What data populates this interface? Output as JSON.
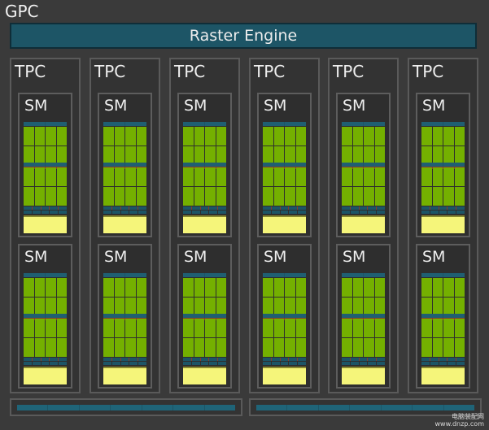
{
  "gpc": {
    "title": "GPC",
    "raster_engine_label": "Raster Engine",
    "tpcs": [
      {
        "label": "TPC",
        "sms": [
          {
            "label": "SM"
          },
          {
            "label": "SM"
          }
        ]
      },
      {
        "label": "TPC",
        "sms": [
          {
            "label": "SM"
          },
          {
            "label": "SM"
          }
        ]
      },
      {
        "label": "TPC",
        "sms": [
          {
            "label": "SM"
          },
          {
            "label": "SM"
          }
        ]
      },
      {
        "label": "TPC",
        "sms": [
          {
            "label": "SM"
          },
          {
            "label": "SM"
          }
        ]
      },
      {
        "label": "TPC",
        "sms": [
          {
            "label": "SM"
          },
          {
            "label": "SM"
          }
        ]
      },
      {
        "label": "TPC",
        "sms": [
          {
            "label": "SM"
          },
          {
            "label": "SM"
          }
        ]
      }
    ]
  },
  "colors": {
    "background": "#3a3a3a",
    "raster_engine": "#1d5566",
    "cuda_cores": "#74b000",
    "register_strip": "#8a3a2a",
    "shared_memory": "#f5f57a"
  },
  "watermark": {
    "line1": "电脑装配网",
    "line2": "www.dnzp.com"
  }
}
